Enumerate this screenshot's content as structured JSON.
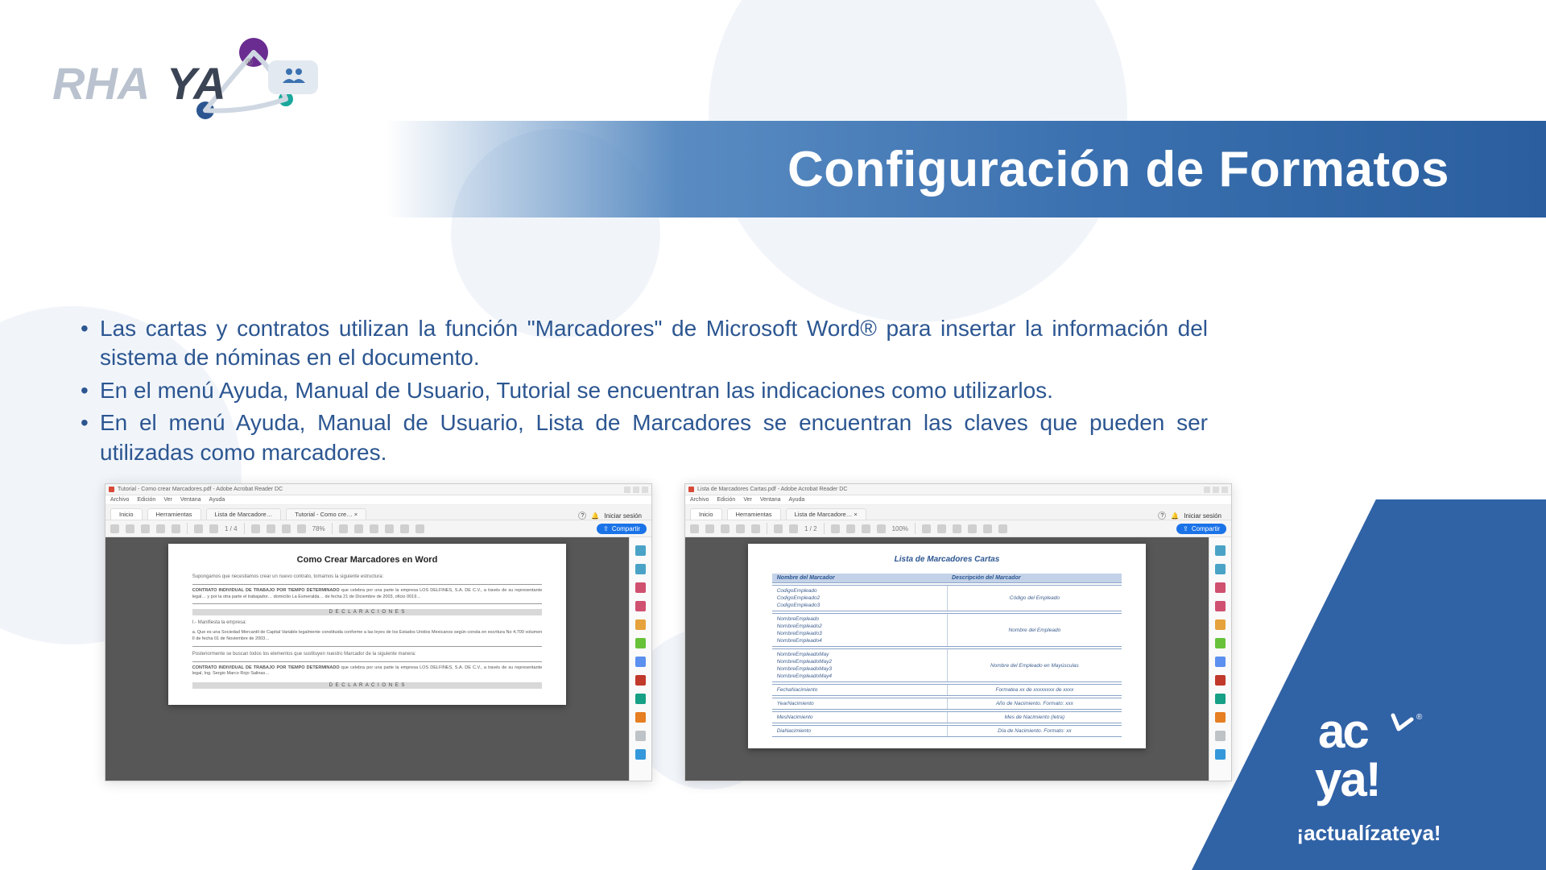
{
  "title": "Configuración de Formatos",
  "logo": {
    "text1": "RHA",
    "text2": "YA"
  },
  "bullets": [
    "Las cartas y contratos utilizan la función \"Marcadores\" de Microsoft Word® para insertar la información del sistema de nóminas en el documento.",
    "En el menú Ayuda, Manual de Usuario, Tutorial se encuentran las indicaciones como utilizarlos.",
    "En el menú Ayuda, Manual de Usuario, Lista de Marcadores se encuentran las claves que pueden ser utilizadas como marcadores."
  ],
  "pdf_left": {
    "window_title": "Tutorial - Como crear Marcadores.pdf - Adobe Acrobat Reader DC",
    "menubar": [
      "Archivo",
      "Edición",
      "Ver",
      "Ventana",
      "Ayuda"
    ],
    "tabs": {
      "home": "Inicio",
      "tools": "Herramientas",
      "doc1": "Lista de Marcadore…",
      "doc2": "Tutorial - Como cre… ×"
    },
    "signin": "Iniciar sesión",
    "toolbar": {
      "page": "1 / 4",
      "zoom": "78%",
      "share": "Compartir"
    },
    "page": {
      "heading": "Como Crear Marcadores en Word",
      "intro": "Supongamos que necesitamos crear un nuevo contrato, tomamos la siguiente estructura:",
      "block_title": "CONTRATO INDIVIDUAL DE TRABAJO POR TIEMPO DETERMINADO",
      "declaraciones": "D E C L A R A C I O N E S",
      "sub1": "I.- Manifiesta la empresa:",
      "note": "Posteriormente se buscan todos los elementos que sustituyen nuestro Marcador de la siguiente manera:"
    }
  },
  "pdf_right": {
    "window_title": "Lista de Marcadores Cartas.pdf - Adobe Acrobat Reader DC",
    "menubar": [
      "Archivo",
      "Edición",
      "Ver",
      "Ventana",
      "Ayuda"
    ],
    "tabs": {
      "home": "Inicio",
      "tools": "Herramientas",
      "doc": "Lista de Marcadore… ×"
    },
    "signin": "Iniciar sesión",
    "toolbar": {
      "page": "1 / 2",
      "zoom": "100%",
      "share": "Compartir"
    },
    "page": {
      "heading": "Lista de Marcadores Cartas",
      "col1": "Nombre del Marcador",
      "col2": "Descripción del Marcador",
      "g1": {
        "names": [
          "CodigoEmpleado",
          "CodigoEmpleado2",
          "CodigoEmpleado3"
        ],
        "desc": "Código del Empleado"
      },
      "g2": {
        "names": [
          "NombreEmpleado",
          "NombreEmpleado2",
          "NombreEmpleado3",
          "NombreEmpleado4"
        ],
        "desc": "Nombre del Empleado"
      },
      "g3": {
        "names": [
          "NombreEmpleadoMay",
          "NombreEmpleadoMay2",
          "NombreEmpleadoMay3",
          "NombreEmpleadoMay4"
        ],
        "desc": "Nombre del Empleado en Mayúsculas"
      },
      "g4": {
        "rows": [
          [
            "FechaNacimiento",
            "Formatea xx de xxxxxxxx de xxxx"
          ],
          [
            "YearNacimiento",
            "Año de Nacimiento. Formato: xxx"
          ],
          [
            "MesNacimiento",
            "Mes de Nacimiento (letra)"
          ],
          [
            "DiaNacimiento",
            "Día de Nacimiento. Formato: xx"
          ]
        ]
      }
    }
  },
  "corner": {
    "tagline": "¡actualízateya!"
  },
  "right_rail_colors": [
    "#4aa3c7",
    "#4aa3c7",
    "#d05070",
    "#d05070",
    "#e6a23c",
    "#67c23a",
    "#5b8ff0",
    "#c0392b",
    "#16a085",
    "#e67e22",
    "#bdc3c7",
    "#3498db"
  ]
}
